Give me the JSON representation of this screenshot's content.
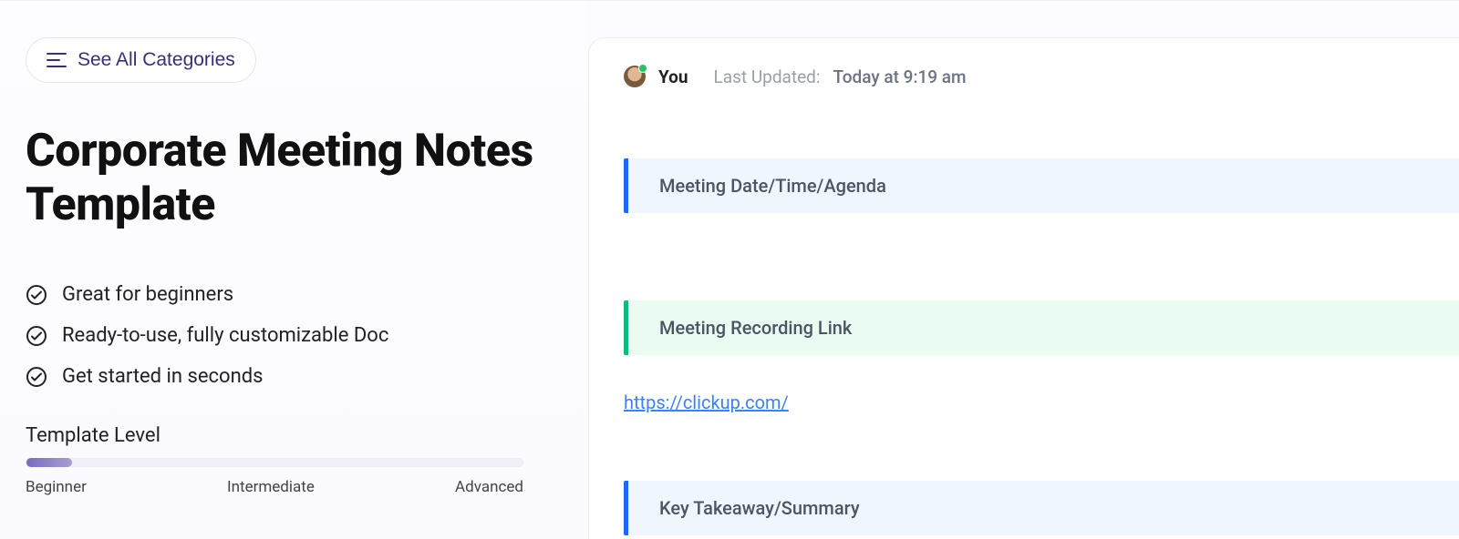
{
  "left": {
    "categories_button": "See All Categories",
    "title": "Corporate Meeting Notes Template",
    "features": [
      "Great for beginners",
      "Ready-to-use, fully customizable Doc",
      "Get started in seconds"
    ],
    "level_label": "Template Level",
    "level_marks": {
      "beginner": "Beginner",
      "intermediate": "Intermediate",
      "advanced": "Advanced"
    }
  },
  "right": {
    "author": "You",
    "updated_label": "Last Updated:",
    "updated_time": "Today at 9:19 am",
    "blocks": {
      "agenda": "Meeting Date/Time/Agenda",
      "recording": "Meeting Recording Link",
      "summary": "Key Takeaway/Summary"
    },
    "link_text": "https://clickup.com/",
    "link_href": "https://clickup.com/"
  }
}
